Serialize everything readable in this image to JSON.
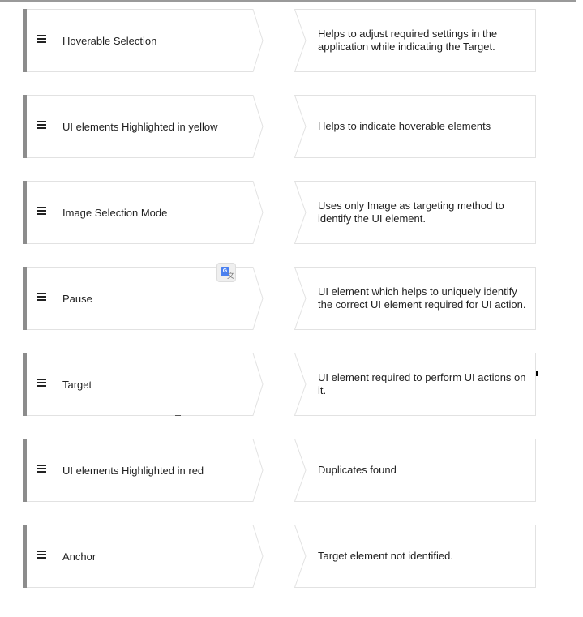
{
  "pairs": [
    {
      "term": "Hoverable Selection",
      "definition": "Helps to adjust required settings in the application while indicating the Target."
    },
    {
      "term": "UI elements Highlighted in yellow",
      "definition": "Helps to indicate hoverable elements"
    },
    {
      "term": "Image Selection Mode",
      "definition": "Uses only Image as targeting method to identify the UI element."
    },
    {
      "term": "Pause",
      "definition": "UI element which helps to uniquely identify the correct UI element required for UI action."
    },
    {
      "term": "Target",
      "definition": "UI element required to perform UI actions on it."
    },
    {
      "term": "UI elements Highlighted in red",
      "definition": "Duplicates found"
    },
    {
      "term": "Anchor",
      "definition": "Target element not identified."
    }
  ],
  "translate_badge": {
    "label": "G"
  },
  "colors": {
    "handle_bar": "#8c8c8c",
    "border": "#e2e2e2"
  }
}
